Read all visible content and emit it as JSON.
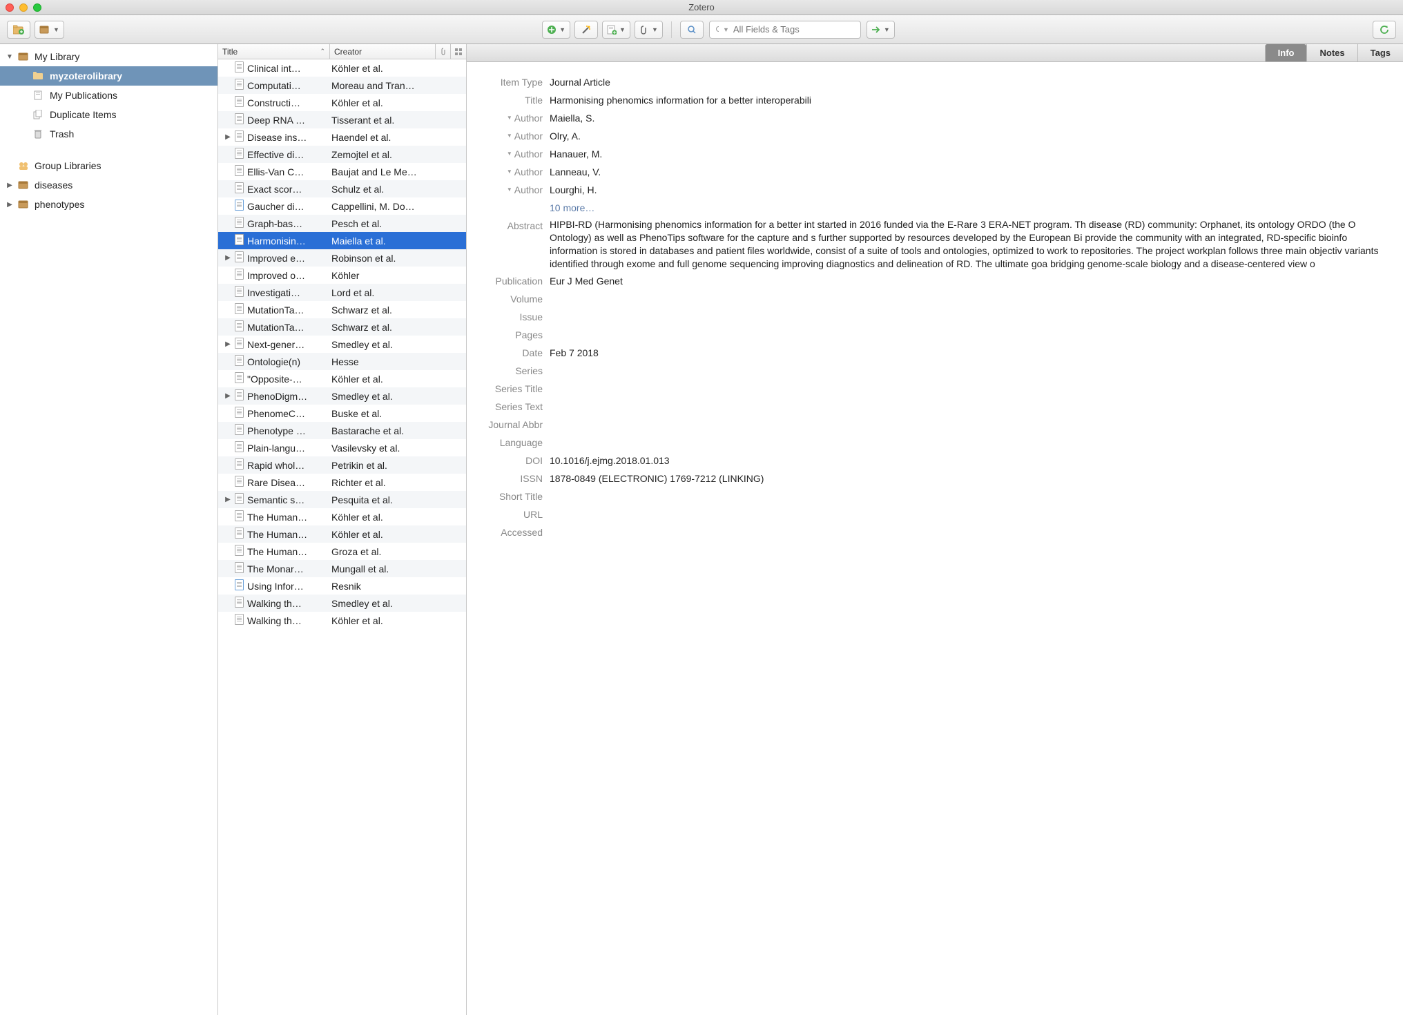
{
  "window": {
    "title": "Zotero"
  },
  "toolbar": {
    "search_placeholder": "All Fields & Tags"
  },
  "sidebar": {
    "my_library": "My Library",
    "collection_selected": "myzoterolibrary",
    "my_publications": "My Publications",
    "duplicate_items": "Duplicate Items",
    "trash": "Trash",
    "group_libraries": "Group Libraries",
    "diseases": "diseases",
    "phenotypes": "phenotypes"
  },
  "columns": {
    "title": "Title",
    "creator": "Creator"
  },
  "items": [
    {
      "title": "Clinical int…",
      "creator": "Köhler et al.",
      "expand": false
    },
    {
      "title": "Computati…",
      "creator": "Moreau and Tran…",
      "expand": false
    },
    {
      "title": "Constructi…",
      "creator": "Köhler et al.",
      "expand": false
    },
    {
      "title": "Deep RNA …",
      "creator": "Tisserant et al.",
      "expand": false
    },
    {
      "title": "Disease ins…",
      "creator": "Haendel et al.",
      "expand": true
    },
    {
      "title": "Effective di…",
      "creator": "Zemojtel et al.",
      "expand": false
    },
    {
      "title": "Ellis-Van C…",
      "creator": "Baujat and Le Me…",
      "expand": false
    },
    {
      "title": "Exact scor…",
      "creator": "Schulz et al.",
      "expand": false
    },
    {
      "title": "Gaucher di…",
      "creator": "Cappellini, M. Do…",
      "expand": false,
      "alt_icon": true
    },
    {
      "title": "Graph-bas…",
      "creator": "Pesch et al.",
      "expand": false
    },
    {
      "title": "Harmonisin…",
      "creator": "Maiella et al.",
      "expand": false,
      "selected": true
    },
    {
      "title": "Improved e…",
      "creator": "Robinson et al.",
      "expand": true
    },
    {
      "title": "Improved o…",
      "creator": "Köhler",
      "expand": false
    },
    {
      "title": "Investigati…",
      "creator": "Lord et al.",
      "expand": false
    },
    {
      "title": "MutationTa…",
      "creator": "Schwarz et al.",
      "expand": false
    },
    {
      "title": "MutationTa…",
      "creator": "Schwarz et al.",
      "expand": false
    },
    {
      "title": "Next-gener…",
      "creator": "Smedley et al.",
      "expand": true
    },
    {
      "title": "Ontologie(n)",
      "creator": "Hesse",
      "expand": false
    },
    {
      "title": "\"Opposite-…",
      "creator": "Köhler et al.",
      "expand": false
    },
    {
      "title": "PhenoDigm…",
      "creator": "Smedley et al.",
      "expand": true
    },
    {
      "title": "PhenomeC…",
      "creator": "Buske et al.",
      "expand": false
    },
    {
      "title": "Phenotype …",
      "creator": "Bastarache et al.",
      "expand": false
    },
    {
      "title": "Plain-langu…",
      "creator": "Vasilevsky et al.",
      "expand": false
    },
    {
      "title": "Rapid whol…",
      "creator": "Petrikin et al.",
      "expand": false
    },
    {
      "title": "Rare Disea…",
      "creator": "Richter et al.",
      "expand": false
    },
    {
      "title": "Semantic s…",
      "creator": "Pesquita et al.",
      "expand": true
    },
    {
      "title": "The Human…",
      "creator": "Köhler et al.",
      "expand": false
    },
    {
      "title": "The Human…",
      "creator": "Köhler et al.",
      "expand": false
    },
    {
      "title": "The Human…",
      "creator": "Groza et al.",
      "expand": false
    },
    {
      "title": "The Monar…",
      "creator": "Mungall et al.",
      "expand": false
    },
    {
      "title": "Using Infor…",
      "creator": "Resnik",
      "expand": false,
      "alt_icon": true
    },
    {
      "title": "Walking th…",
      "creator": "Smedley et al.",
      "expand": false
    },
    {
      "title": "Walking th…",
      "creator": "Köhler et al.",
      "expand": false
    }
  ],
  "tabs": {
    "info": "Info",
    "notes": "Notes",
    "tags": "Tags"
  },
  "detail": {
    "item_type_label": "Item Type",
    "item_type": "Journal Article",
    "title_label": "Title",
    "title": "Harmonising phenomics information for a better interoperabili",
    "author_label": "Author",
    "authors": [
      "Maiella, S.",
      "Olry, A.",
      "Hanauer, M.",
      "Lanneau, V.",
      "Lourghi, H."
    ],
    "more": "10 more…",
    "abstract_label": "Abstract",
    "abstract": "HIPBI-RD (Harmonising phenomics information for a better int started in 2016 funded via the E-Rare 3 ERA-NET program. Th disease (RD) community: Orphanet, its ontology ORDO (the O Ontology) as well as PhenoTips software for the capture and s further supported by resources developed by the European Bi provide the community with an integrated, RD-specific bioinfo information is stored in databases and patient files worldwide, consist of a suite of tools and ontologies, optimized to work to repositories. The project workplan follows three main objectiv variants identified through exome and full genome sequencing improving diagnostics and delineation of RD. The ultimate goa bridging genome-scale biology and a disease-centered view o",
    "publication_label": "Publication",
    "publication": "Eur J Med Genet",
    "volume_label": "Volume",
    "volume": "",
    "issue_label": "Issue",
    "issue": "",
    "pages_label": "Pages",
    "pages": "",
    "date_label": "Date",
    "date": "Feb 7 2018",
    "series_label": "Series",
    "series": "",
    "series_title_label": "Series Title",
    "series_title": "",
    "series_text_label": "Series Text",
    "series_text": "",
    "journal_abbr_label": "Journal Abbr",
    "journal_abbr": "",
    "language_label": "Language",
    "language": "",
    "doi_label": "DOI",
    "doi": "10.1016/j.ejmg.2018.01.013",
    "issn_label": "ISSN",
    "issn": "1878-0849 (ELECTRONIC) 1769-7212 (LINKING)",
    "short_title_label": "Short Title",
    "short_title": "",
    "url_label": "URL",
    "url": "",
    "accessed_label": "Accessed",
    "accessed": ""
  }
}
